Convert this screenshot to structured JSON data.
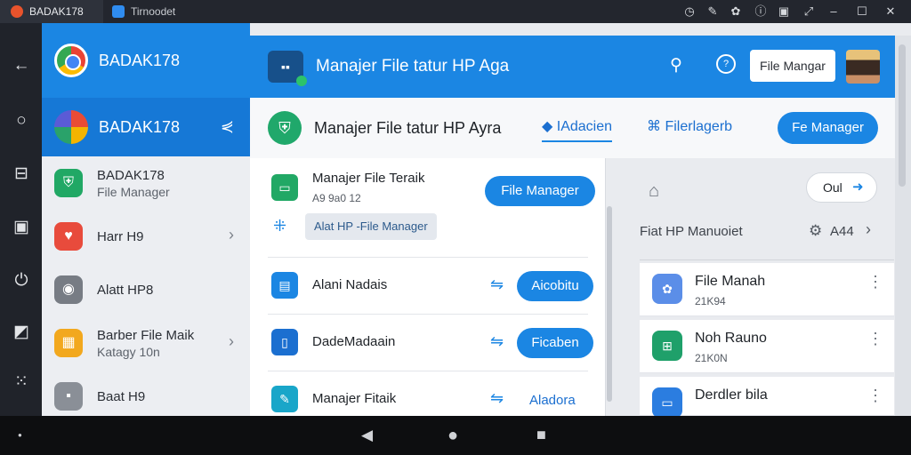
{
  "titlebar": {
    "tabs": [
      {
        "label": "BADAK178",
        "icon": "app-logo-icon"
      },
      {
        "label": "Tirnoodet",
        "icon": "window-icon"
      }
    ],
    "tray_icons": [
      "clock-icon",
      "feather-icon",
      "palette-icon",
      "info-icon",
      "square-icon",
      "expand-icon",
      "minimize-icon",
      "maximize-icon",
      "close-icon"
    ]
  },
  "rail": {
    "icons": [
      "back-arrow-icon",
      "circle-icon",
      "layout-icon",
      "media-icon",
      "power-icon",
      "crop-icon",
      "grid-dots-icon"
    ]
  },
  "sidebar": {
    "header_title": "BADAK178",
    "selected_title": "BADAK178",
    "items": [
      {
        "label": "BADAK178",
        "sub": "File Manager",
        "icon": "shield-icon",
        "color": "#21a865"
      },
      {
        "label": "Harr H9",
        "sub": "",
        "icon": "heart-icon",
        "color": "#e84b3c",
        "chevron": true
      },
      {
        "label": "Alatt HP8",
        "sub": "",
        "icon": "camera-icon",
        "color": "#777c84",
        "chevron": false
      },
      {
        "label": "Barber File Maik",
        "sub": "Katagy 10n",
        "icon": "grid-icon",
        "color": "#f2a81e",
        "chevron": true
      },
      {
        "label": "Baat H9",
        "sub": "",
        "icon": "box-icon",
        "color": "#8a8f97",
        "chevron": false
      }
    ]
  },
  "appbar": {
    "title": "Manajer File tatur HP Aga",
    "button": "File Mangar",
    "icon": "folder-app-icon"
  },
  "subhead": {
    "title": "Manajer File tatur HP Ayra",
    "tab_active": "IAdacien",
    "tab_other": "Filerlagerb",
    "button": "Fe Manager"
  },
  "panel": {
    "top_card": {
      "title": "Manajer File Teraik",
      "sub": "A9 9a0 12",
      "button": "File Manager",
      "chip": "Alat HP -File Manager"
    },
    "rows": [
      {
        "title": "Alani Nadais",
        "button": "Aicobitu",
        "icon": "doc-icon",
        "color": "#1b86e3"
      },
      {
        "title": "DadeMadaain",
        "button": "Ficaben",
        "icon": "device-icon",
        "color": "#1b6fd0"
      },
      {
        "title": "Manajer Fitaik",
        "button": "Aladora",
        "icon": "chat-icon",
        "color": "#19a6c9"
      }
    ]
  },
  "rightpane": {
    "toggle": "Oul",
    "label": "Fiat HP Manuoiet",
    "count": "A44",
    "items": [
      {
        "title": "File Manah",
        "sub": "21K94",
        "icon": "palette-app-icon",
        "color": "#5b8ee8"
      },
      {
        "title": "Noh Rauno",
        "sub": "21K0N",
        "icon": "folder-green-icon",
        "color": "#1fa06a"
      },
      {
        "title": "Derdler bila",
        "sub": "",
        "icon": "folder-blue-icon",
        "color": "#2b7de0"
      }
    ]
  }
}
